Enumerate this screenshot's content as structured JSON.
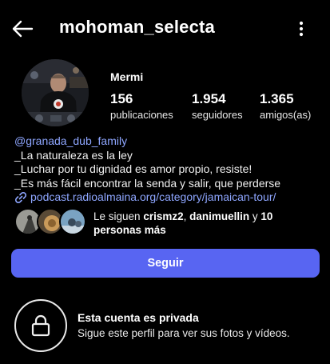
{
  "header": {
    "username": "mohoman_selecta",
    "back_icon": "arrow-left-icon",
    "more_icon": "vertical-dots-icon"
  },
  "profile": {
    "display_name": "Mermi",
    "stats": {
      "posts": {
        "value": "156",
        "label": "publicaciones"
      },
      "followers": {
        "value": "1.954",
        "label": "seguidores"
      },
      "friends": {
        "value": "1.365",
        "label": "amigos(as)"
      }
    }
  },
  "bio": {
    "mention": "@granada_dub_family",
    "lines": [
      "_La naturaleza es la ley",
      "_Luchar por tu dignidad es amor propio, resiste!",
      "_Es más fácil encontrar la senda y salir, que perderse"
    ],
    "link": "podcast.radioalmaina.org/category/jamaican-tour/",
    "link_icon": "link-icon"
  },
  "followed_by": {
    "prefix": "Le siguen ",
    "user1": "crismz2",
    "separator": ", ",
    "user2": "danimuellin",
    "conjunction": " y ",
    "others": "10 personas más"
  },
  "follow_button": {
    "label": "Seguir",
    "color": "#5865f2"
  },
  "private_notice": {
    "title": "Esta cuenta es privada",
    "subtitle": "Sigue este perfil para ver sus fotos y vídeos.",
    "icon": "lock-icon"
  },
  "colors": {
    "background": "#000000",
    "link": "#8ea6ff",
    "accent": "#5865f2"
  }
}
